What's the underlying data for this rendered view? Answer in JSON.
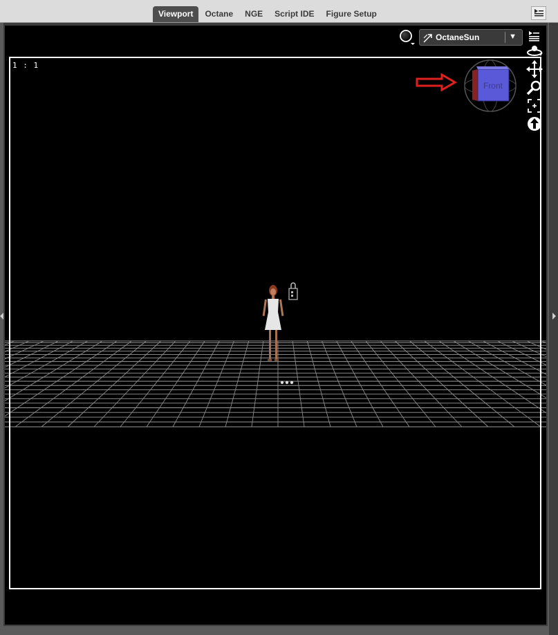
{
  "tabs": [
    {
      "label": "Viewport",
      "active": true
    },
    {
      "label": "Octane",
      "active": false
    },
    {
      "label": "NGE",
      "active": false
    },
    {
      "label": "Script IDE",
      "active": false
    },
    {
      "label": "Figure Setup",
      "active": false
    }
  ],
  "viewport": {
    "aspect_label": "1 : 1",
    "camera_label": "OctaneSun",
    "view_cube_face": "Front"
  },
  "icons": {
    "pane_menu": "pane-menu-icon",
    "draw_style": "draw-style-sphere-icon",
    "camera": "camera-icon",
    "dropdown": "chevron-down-icon",
    "view_options": "view-options-icon",
    "orbit": "orbit-icon",
    "translate": "translate-icon",
    "zoom": "zoom-icon",
    "frame": "frame-icon",
    "reset": "reset-view-icon"
  },
  "colors": {
    "tabbar_bg": "#dcdcdc",
    "active_tab": "#4e4e4e",
    "viewport_bg": "#000000",
    "cube_face": "#5a5ad8",
    "annotation_arrow": "#e0201e"
  }
}
